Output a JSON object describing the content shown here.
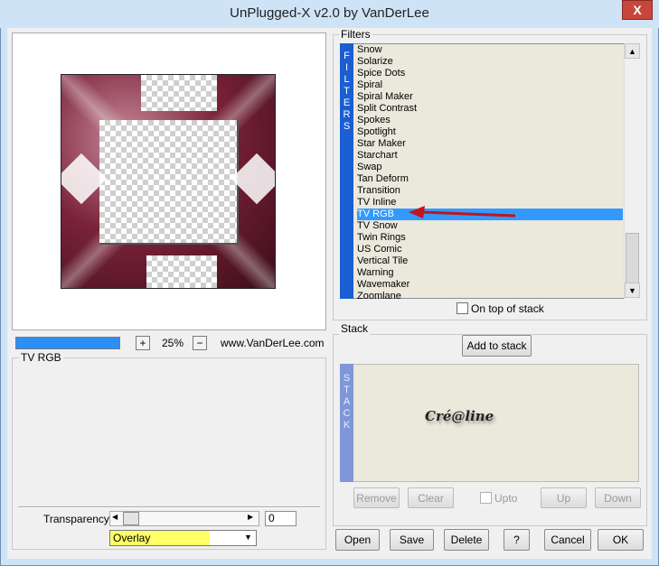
{
  "window": {
    "title": "UnPlugged-X v2.0 by VanDerLee",
    "close_symbol": "X"
  },
  "filters": {
    "group_label": "Filters",
    "bar_label": [
      "F",
      "I",
      "L",
      "T",
      "E",
      "R",
      "S"
    ],
    "items": [
      "Snow",
      "Solarize",
      "Spice Dots",
      "Spiral",
      "Spiral Maker",
      "Split Contrast",
      "Spokes",
      "Spotlight",
      "Star Maker",
      "Starchart",
      "Swap",
      "Tan Deform",
      "Transition",
      "TV Inline",
      "TV RGB",
      "TV Snow",
      "Twin Rings",
      "US Comic",
      "Vertical Tile",
      "Warning",
      "Wavemaker",
      "Zoomlane"
    ],
    "selected": "TV RGB",
    "on_top_label": "On top of stack",
    "scroll_up": "▲",
    "scroll_down": "▼"
  },
  "zoom": {
    "plus": "+",
    "minus": "−",
    "value": "25%",
    "website": "www.VanDerLee.com"
  },
  "settings": {
    "group_label": "TV RGB",
    "transparency_label": "Transparency",
    "transparency_value": "0",
    "blend_mode": "Overlay",
    "slider_left": "◀",
    "slider_right": "▶",
    "dropdown_arrow": "▼"
  },
  "stack": {
    "group_label": "Stack",
    "add_button": "Add to stack",
    "bar_label": [
      "S",
      "T",
      "A",
      "C",
      "K"
    ],
    "watermark": "Cré@line",
    "remove": "Remove",
    "clear": "Clear",
    "upto": "Upto",
    "up": "Up",
    "down": "Down"
  },
  "bottom_buttons": {
    "open": "Open",
    "save": "Save",
    "delete": "Delete",
    "help": "?",
    "cancel": "Cancel",
    "ok": "OK"
  },
  "colors": {
    "selection": "#3399ff",
    "arrow": "#c0161c",
    "filters_bar": "#1a5ed1",
    "highlight": "#ffff66"
  }
}
